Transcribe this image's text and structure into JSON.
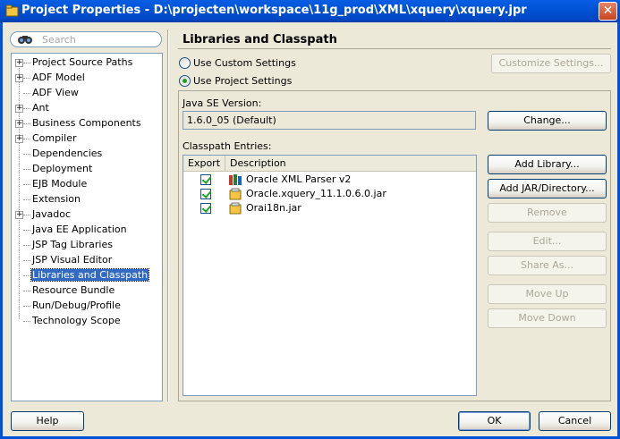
{
  "window": {
    "title": "Project Properties - D:\\projecten\\workspace\\11g_prod\\XML\\xquery\\xquery.jpr",
    "close_glyph": "✕"
  },
  "search": {
    "placeholder": "Search",
    "icon": "binoculars-icon"
  },
  "tree": {
    "items": [
      {
        "label": "Project Source Paths",
        "expandable": true
      },
      {
        "label": "ADF Model",
        "expandable": true
      },
      {
        "label": "ADF View",
        "expandable": false
      },
      {
        "label": "Ant",
        "expandable": true
      },
      {
        "label": "Business Components",
        "expandable": true
      },
      {
        "label": "Compiler",
        "expandable": true
      },
      {
        "label": "Dependencies",
        "expandable": false
      },
      {
        "label": "Deployment",
        "expandable": false
      },
      {
        "label": "EJB Module",
        "expandable": false
      },
      {
        "label": "Extension",
        "expandable": false
      },
      {
        "label": "Javadoc",
        "expandable": true
      },
      {
        "label": "Java EE Application",
        "expandable": false
      },
      {
        "label": "JSP Tag Libraries",
        "expandable": false
      },
      {
        "label": "JSP Visual Editor",
        "expandable": false
      },
      {
        "label": "Libraries and Classpath",
        "expandable": false,
        "selected": true
      },
      {
        "label": "Resource Bundle",
        "expandable": false
      },
      {
        "label": "Run/Debug/Profile",
        "expandable": false
      },
      {
        "label": "Technology Scope",
        "expandable": false
      }
    ]
  },
  "main": {
    "title": "Libraries and Classpath",
    "radio_custom": "Use Custom Settings",
    "radio_project": "Use Project Settings",
    "selected_radio": "project",
    "customize_button": "Customize Settings...",
    "java_se_label": "Java SE Version:",
    "java_se_value": "1.6.0_05 (Default)",
    "change_button": "Change...",
    "classpath_label": "Classpath Entries:",
    "table": {
      "headers": [
        "Export",
        "Description"
      ],
      "rows": [
        {
          "export": true,
          "description": "Oracle XML Parser v2",
          "icon": "library-icon"
        },
        {
          "export": true,
          "description": "Oracle.xquery_11.1.0.6.0.jar",
          "icon": "jar-icon"
        },
        {
          "export": true,
          "description": "Orai18n.jar",
          "icon": "jar-icon"
        }
      ]
    },
    "buttons": {
      "add_library": "Add Library...",
      "add_jar": "Add JAR/Directory...",
      "remove": "Remove",
      "edit": "Edit...",
      "share_as": "Share As...",
      "move_up": "Move Up",
      "move_down": "Move Down"
    }
  },
  "footer": {
    "help": "Help",
    "ok": "OK",
    "cancel": "Cancel"
  },
  "colors": {
    "titlebar": "#0053d6",
    "selection": "#316ac5",
    "dialog_bg": "#ece9d8"
  }
}
